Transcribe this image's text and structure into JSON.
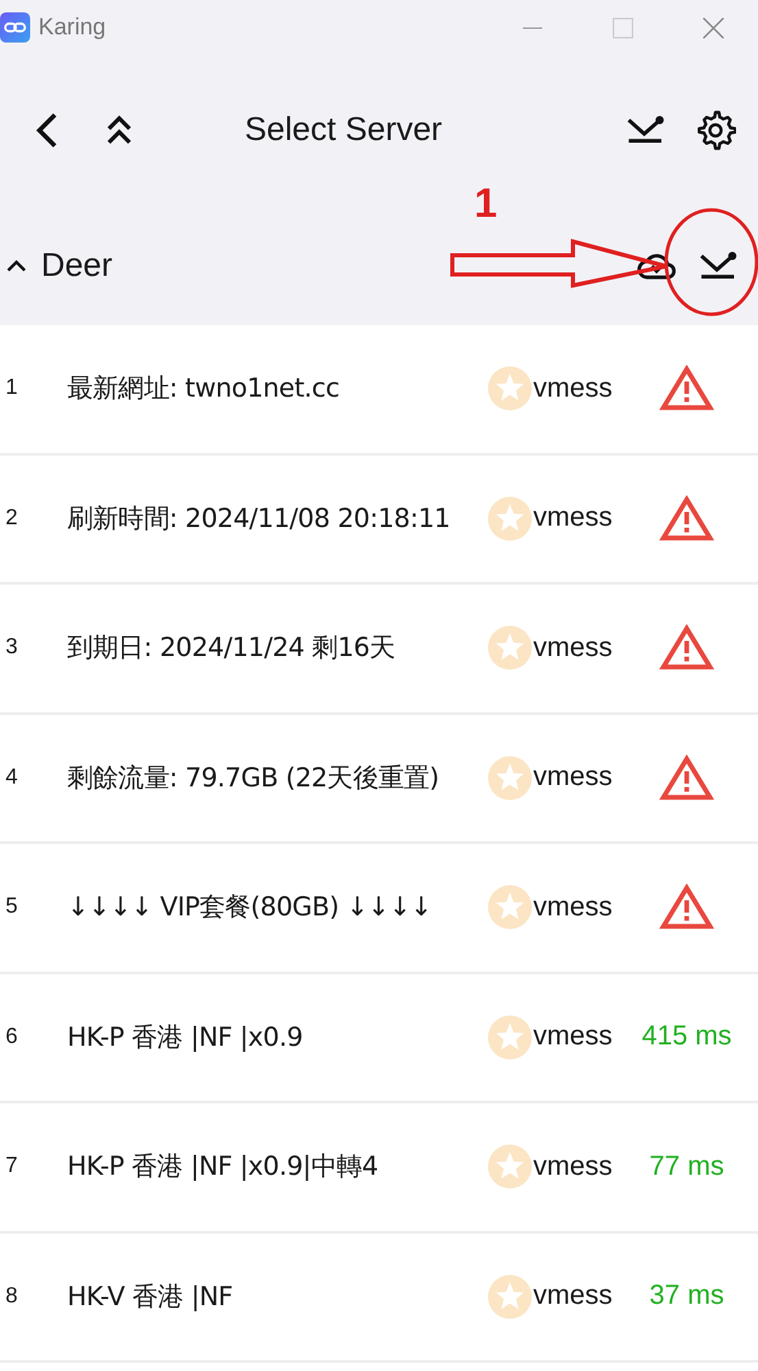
{
  "window": {
    "title": "Karing"
  },
  "toolbar": {
    "title": "Select Server"
  },
  "group": {
    "name": "Deer",
    "expanded": true
  },
  "annotation": {
    "label": "1"
  },
  "servers": [
    {
      "index": "1",
      "name": "最新網址: twno1net.cc",
      "favorite": false,
      "protocol": "vmess",
      "kind": "error"
    },
    {
      "index": "2",
      "name": "刷新時間: 2024/11/08 20:18:11",
      "favorite": false,
      "protocol": "vmess",
      "kind": "error"
    },
    {
      "index": "3",
      "name": "到期日: 2024/11/24 剩16天",
      "favorite": false,
      "protocol": "vmess",
      "kind": "error"
    },
    {
      "index": "4",
      "name": "剩餘流量: 79.7GB (22天後重置)",
      "favorite": false,
      "protocol": "vmess",
      "kind": "error"
    },
    {
      "index": "5",
      "name": "↓↓↓↓ VIP套餐(80GB) ↓↓↓↓",
      "favorite": false,
      "protocol": "vmess",
      "kind": "error"
    },
    {
      "index": "6",
      "name": "HK-P 香港 |NF |x0.9",
      "favorite": false,
      "protocol": "vmess",
      "kind": "latency",
      "latency": "415 ms"
    },
    {
      "index": "7",
      "name": "HK-P 香港 |NF |x0.9|中轉4",
      "favorite": false,
      "protocol": "vmess",
      "kind": "latency",
      "latency": "77 ms"
    },
    {
      "index": "8",
      "name": "HK-V 香港 |NF",
      "favorite": false,
      "protocol": "vmess",
      "kind": "latency",
      "latency": "37 ms"
    }
  ]
}
